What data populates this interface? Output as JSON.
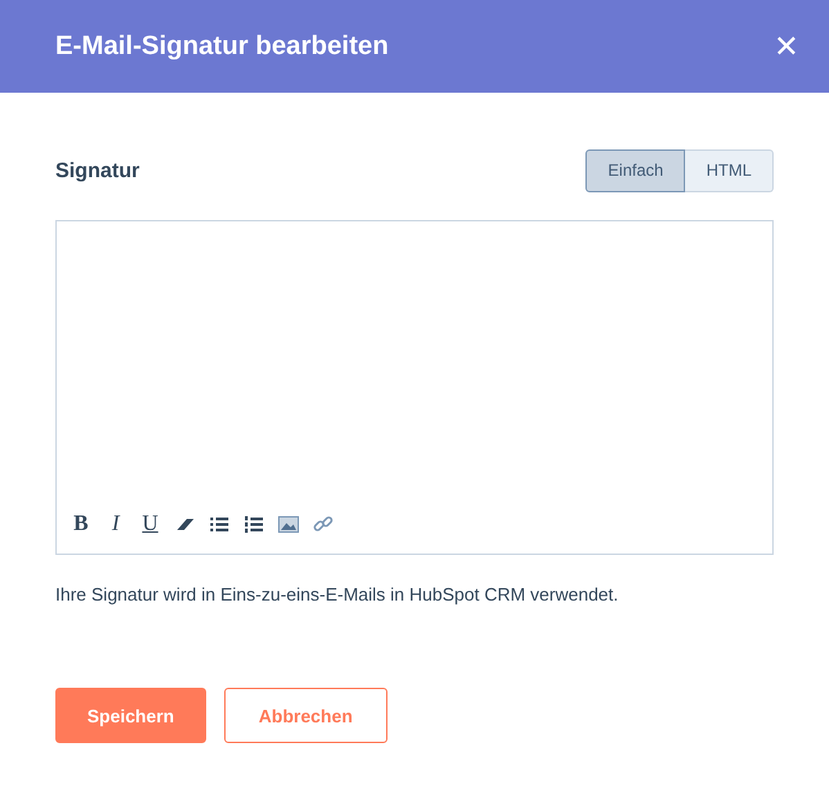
{
  "window": {
    "title": "E-Mail-Signatur bearbeiten",
    "close": "✕"
  },
  "signature": {
    "label": "Signatur",
    "modes": [
      {
        "label": "Einfach",
        "selected": true
      },
      {
        "label": "HTML",
        "selected": false
      }
    ]
  },
  "toolbar": [
    {
      "kind": "bold",
      "label": "B"
    },
    {
      "kind": "italic",
      "label": "I"
    },
    {
      "kind": "underline",
      "label": "U"
    },
    {
      "kind": "eraser"
    },
    {
      "kind": "bullets"
    },
    {
      "kind": "numbered"
    },
    {
      "kind": "image"
    },
    {
      "kind": "link"
    }
  ],
  "help": "Ihre Signatur wird in Eins-zu-eins-E-Mails in HubSpot CRM verwendet.",
  "buttons": [
    {
      "label": "Speichern",
      "kind": "primary"
    },
    {
      "label": "Abbrechen",
      "kind": "secondary"
    }
  ]
}
